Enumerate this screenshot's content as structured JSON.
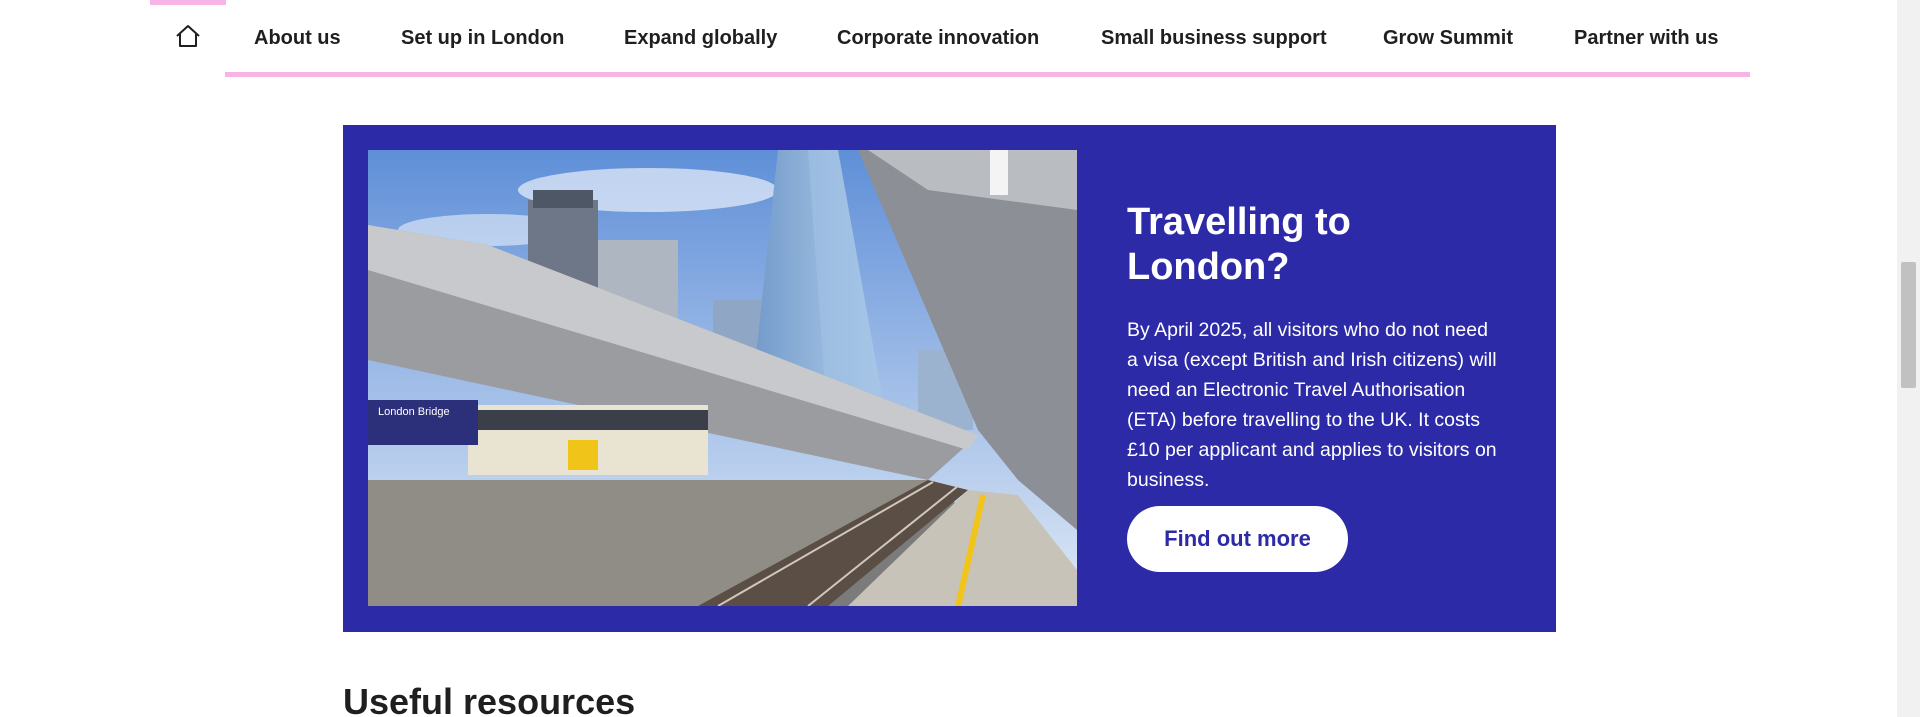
{
  "nav": {
    "home_icon": "home-icon",
    "items": [
      {
        "label": "About us"
      },
      {
        "label": "Set up in London"
      },
      {
        "label": "Expand globally"
      },
      {
        "label": "Corporate innovation"
      },
      {
        "label": "Small business support"
      },
      {
        "label": "Grow Summit"
      },
      {
        "label": "Partner with us"
      }
    ]
  },
  "banner": {
    "image_alt": "London Bridge station platform with The Shard",
    "title": "Travelling to London?",
    "text": "By April 2025, all visitors who do not need a visa (except British and Irish citizens) will need an Electronic Travel Authorisation (ETA) before travelling to the UK. It costs £10 per applicant and applies to visitors on business.",
    "button_label": "Find out more",
    "sign_text": "London Bridge"
  },
  "resources": {
    "heading": "Useful resources"
  },
  "colors": {
    "accent_pink": "#f7b4e6",
    "banner_blue": "#2c2aa6",
    "button_bg": "#ffffff",
    "text_dark": "#1f1f1f"
  }
}
